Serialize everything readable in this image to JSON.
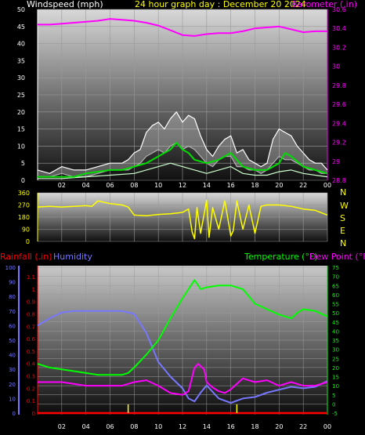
{
  "header": {
    "windspeed_label": "Windspeed (mph)",
    "title": "24 hour graph day : December 20 2024",
    "barometer_label": "Barometer (.in)"
  },
  "direction_labels": [
    "N",
    "W",
    "S",
    "E",
    "N"
  ],
  "bottom_header": {
    "rainfall_label": "Rainfall (.in)",
    "humidity_label": "Humidity",
    "temperature_label": "Temperature (°F)",
    "dewpoint_label": "Dew Point (°F)"
  },
  "colors": {
    "wind": "#ffffff",
    "gust": "#00dd00",
    "windchill": "#ccffcc",
    "barometer": "#ff00ff",
    "direction": "#ffff00",
    "humidity": "#7777ff",
    "temperature": "#00ff00",
    "dewpoint": "#ff00ff",
    "rain": "#ff0000",
    "rainrate": "#ffff00"
  },
  "chart_data": [
    {
      "type": "line",
      "x_ticks": [
        "02",
        "04",
        "06",
        "08",
        "10",
        "12",
        "14",
        "16",
        "18",
        "20",
        "22",
        "00"
      ],
      "y_ticks_left": [
        "0",
        "5",
        "10",
        "15",
        "20",
        "25",
        "30",
        "35",
        "40",
        "45",
        "50"
      ],
      "y_ticks_right": [
        "28.8",
        "29",
        "29.2",
        "29.4",
        "29.6",
        "29.8",
        "30",
        "30.2",
        "30.4",
        "30.6"
      ],
      "ylim_left": [
        0,
        50
      ],
      "ylim_right": [
        28.8,
        30.6
      ],
      "xlim": [
        0,
        24
      ],
      "series": [
        {
          "id": "barometer",
          "x": [
            0,
            1,
            2,
            3,
            4,
            5,
            6,
            7,
            8,
            9,
            10,
            11,
            12,
            13,
            14,
            15,
            16,
            17,
            18,
            19,
            20,
            21,
            22,
            23,
            24
          ],
          "values": [
            30.44,
            30.44,
            30.45,
            30.46,
            30.47,
            30.48,
            30.5,
            30.49,
            30.48,
            30.46,
            30.43,
            30.38,
            30.33,
            30.32,
            30.34,
            30.35,
            30.35,
            30.37,
            30.4,
            30.41,
            30.42,
            30.39,
            30.36,
            30.37,
            30.37
          ]
        },
        {
          "id": "wind_high",
          "x": [
            0,
            1,
            2,
            3,
            4,
            5,
            6,
            7,
            7.5,
            8,
            8.5,
            9,
            9.5,
            10,
            10.5,
            11,
            11.5,
            12,
            12.5,
            13,
            13.5,
            14,
            14.5,
            15,
            15.5,
            16,
            16.5,
            17,
            17.5,
            18,
            18.5,
            19,
            19.5,
            20,
            20.5,
            21,
            21.5,
            22,
            22.5,
            23,
            23.5,
            24
          ],
          "values": [
            3,
            2,
            4,
            3,
            3,
            4,
            5,
            5,
            6,
            8,
            9,
            14,
            16,
            17,
            15,
            18,
            20,
            17,
            19,
            18,
            13,
            9,
            7,
            10,
            12,
            13,
            8,
            9,
            6,
            5,
            4,
            5,
            12,
            15,
            14,
            13,
            10,
            8,
            6,
            5,
            5,
            3
          ]
        },
        {
          "id": "wind_avg",
          "x": [
            0,
            1,
            2,
            3,
            4,
            5,
            6,
            7,
            7.5,
            8,
            8.5,
            9,
            9.5,
            10,
            10.5,
            11,
            11.5,
            12,
            12.5,
            13,
            13.5,
            14,
            14.5,
            15,
            15.5,
            16,
            16.5,
            17,
            17.5,
            18,
            18.5,
            19,
            19.5,
            20,
            20.5,
            21,
            21.5,
            22,
            22.5,
            23,
            23.5,
            24
          ],
          "values": [
            1,
            1,
            2,
            1,
            1,
            2,
            3,
            3,
            3,
            4,
            5,
            7,
            8,
            9,
            8,
            10,
            11,
            9,
            10,
            9,
            7,
            5,
            4,
            6,
            7,
            7,
            4,
            4,
            3,
            3,
            2,
            3,
            5,
            7,
            6,
            6,
            5,
            4,
            3,
            3,
            2,
            2
          ]
        },
        {
          "id": "gust",
          "x": [
            0,
            2,
            3,
            4,
            6,
            7,
            8,
            9,
            10,
            11,
            11.5,
            12,
            12.5,
            13,
            14,
            15,
            16,
            16.5,
            17,
            18,
            19,
            20,
            20.5,
            21,
            22,
            23,
            24
          ],
          "values": [
            1,
            1,
            1,
            2,
            3,
            3,
            4,
            5,
            7,
            9,
            11,
            9,
            8,
            6,
            5,
            6,
            8,
            6,
            4,
            3,
            3,
            5,
            8,
            7,
            4,
            3,
            2
          ]
        },
        {
          "id": "windchill",
          "x": [
            0,
            2,
            4,
            6,
            8,
            9,
            10,
            11,
            12,
            13,
            14,
            15,
            16,
            17,
            18,
            19,
            20,
            21,
            22,
            23,
            24
          ],
          "values": [
            0.5,
            0.5,
            1,
            1.5,
            2,
            3,
            4,
            5,
            4,
            3,
            2,
            3,
            4,
            2,
            1.5,
            1.5,
            2.5,
            3,
            2,
            1.5,
            1
          ]
        }
      ]
    },
    {
      "type": "line",
      "x_ticks": [
        "02",
        "04",
        "06",
        "08",
        "10",
        "12",
        "14",
        "16",
        "18",
        "20",
        "22",
        "00"
      ],
      "y_ticks": [
        "0",
        "90",
        "180",
        "270",
        "360"
      ],
      "ylim": [
        0,
        360
      ],
      "xlim": [
        0,
        24
      ],
      "series": [
        {
          "id": "wind_direction",
          "x": [
            0,
            1,
            2,
            3,
            4,
            4.5,
            5,
            6,
            7,
            7.5,
            8,
            9,
            10,
            11,
            12,
            12.5,
            12.8,
            13,
            13.2,
            13.5,
            14,
            14.2,
            14.5,
            15,
            15.5,
            16,
            16.2,
            16.5,
            17,
            17.5,
            18,
            18.5,
            19,
            20,
            21,
            22,
            23,
            24
          ],
          "values": [
            255,
            260,
            255,
            260,
            265,
            260,
            300,
            280,
            270,
            255,
            195,
            190,
            200,
            205,
            215,
            240,
            70,
            20,
            250,
            60,
            305,
            30,
            250,
            90,
            300,
            40,
            80,
            300,
            90,
            270,
            60,
            260,
            270,
            270,
            260,
            240,
            230,
            195
          ]
        }
      ]
    },
    {
      "type": "line",
      "x_ticks": [
        "02",
        "04",
        "06",
        "08",
        "10",
        "12",
        "14",
        "16",
        "18",
        "20",
        "22",
        "00"
      ],
      "y_ticks_humidity": [
        "0",
        "10",
        "20",
        "30",
        "40",
        "50",
        "60",
        "70",
        "80",
        "90",
        "100"
      ],
      "y_ticks_rain": [
        "0",
        "0.1",
        "0.2",
        "0.3",
        "0.4",
        "0.5",
        "0.6",
        "0.7",
        "0.8",
        "0.9",
        "1",
        "1.1"
      ],
      "y_ticks_temp": [
        "-5",
        "0",
        "5",
        "10",
        "15",
        "20",
        "25",
        "30",
        "35",
        "40",
        "45",
        "50",
        "55",
        "60",
        "65",
        "70",
        "75"
      ],
      "ylim_humidity": [
        0,
        100
      ],
      "ylim_rain": [
        0,
        1.1
      ],
      "ylim_temp": [
        -5,
        75
      ],
      "xlim": [
        0,
        24
      ],
      "series": [
        {
          "id": "humidity",
          "x": [
            0,
            1,
            2,
            3,
            4,
            5,
            6,
            7,
            8,
            9,
            10,
            11,
            12,
            12.5,
            13,
            13.5,
            14,
            15,
            16,
            17,
            18,
            19,
            20,
            21,
            22,
            23,
            24
          ],
          "values": [
            60,
            65,
            69,
            70,
            70,
            70,
            70,
            70,
            68,
            55,
            35,
            25,
            17,
            10,
            8,
            14,
            19,
            10,
            7,
            10,
            11,
            14,
            16,
            18,
            17,
            18,
            22
          ]
        },
        {
          "id": "temperature",
          "x": [
            0,
            1,
            2,
            3,
            4,
            5,
            6,
            7,
            7.5,
            8,
            9,
            10,
            11,
            12,
            13,
            13.5,
            14,
            15,
            16,
            17,
            18,
            19,
            20,
            21,
            21.5,
            22,
            23,
            24
          ],
          "values": [
            22,
            20,
            19,
            18,
            17,
            16,
            16,
            16,
            17,
            20,
            27,
            35,
            47,
            58,
            68,
            63,
            64,
            65,
            65,
            63,
            55,
            52,
            49,
            47,
            50,
            52,
            51,
            48
          ]
        },
        {
          "id": "dewpoint",
          "x": [
            0,
            1,
            2,
            3,
            4,
            5,
            6,
            7,
            7.5,
            8,
            9,
            10,
            11,
            12,
            12.5,
            13,
            13.3,
            13.8,
            14,
            14.5,
            15,
            15.5,
            16,
            16.5,
            17,
            18,
            19,
            20,
            21,
            22,
            23,
            24
          ],
          "values": [
            12,
            12,
            12,
            11,
            10,
            10,
            10,
            10,
            11,
            12,
            13,
            10,
            6,
            5,
            7,
            20,
            22,
            19,
            12,
            9,
            7,
            6,
            8,
            11,
            14,
            12,
            13,
            10,
            12,
            10,
            10,
            12
          ]
        },
        {
          "id": "rainfall",
          "x": [
            0,
            24
          ],
          "values": [
            0,
            0
          ]
        },
        {
          "id": "rainrate",
          "x": [
            7.5,
            16.5
          ],
          "values": [
            0.07,
            0.07
          ]
        }
      ]
    }
  ]
}
